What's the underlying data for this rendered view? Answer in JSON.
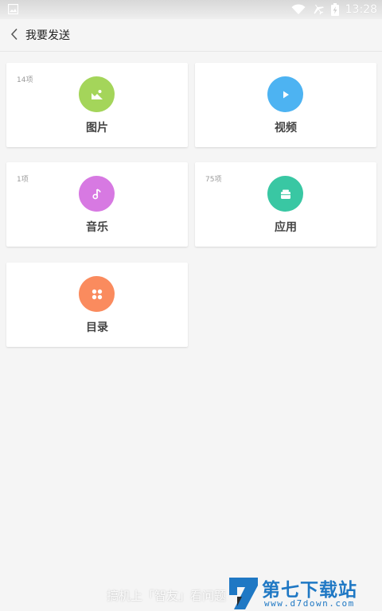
{
  "status_bar": {
    "time": "13:28",
    "icons": [
      "image-icon",
      "wifi-icon",
      "airplane-icon",
      "battery-charging-icon"
    ]
  },
  "header": {
    "back_icon": "chevron-left-icon",
    "title": "我要发送"
  },
  "categories": [
    {
      "label": "图片",
      "count": "14项",
      "color": "#a4d55a",
      "icon": "picture-icon"
    },
    {
      "label": "视频",
      "count": "",
      "color": "#4db3f2",
      "icon": "play-icon"
    },
    {
      "label": "音乐",
      "count": "1项",
      "color": "#d779e2",
      "icon": "music-note-icon"
    },
    {
      "label": "应用",
      "count": "75项",
      "color": "#39c7a3",
      "icon": "app-box-icon"
    },
    {
      "label": "目录",
      "count": "",
      "color": "#fa8b5e",
      "icon": "grid-dots-icon"
    }
  ],
  "watermark": {
    "text": "搞机上「智友」看问题",
    "brand": "第七下载站",
    "url": "www.d7down.com"
  }
}
